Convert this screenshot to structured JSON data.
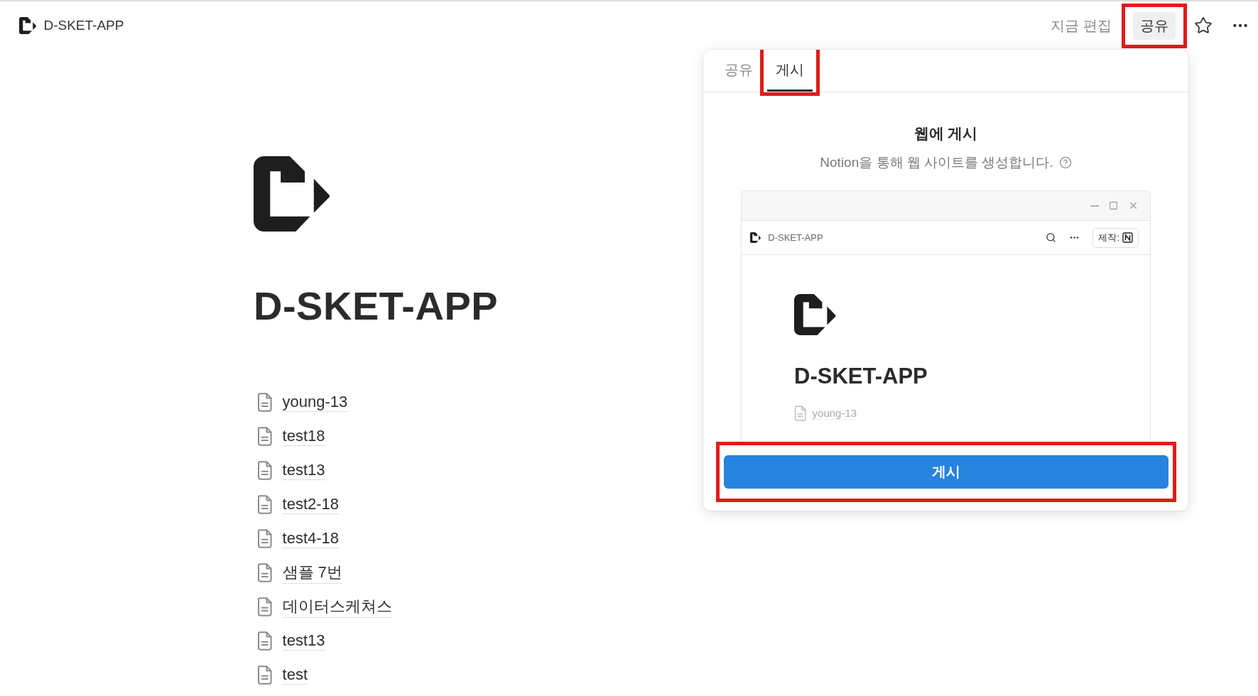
{
  "topbar": {
    "breadcrumb": "D-SKET-APP",
    "edit_status": "지금 편집",
    "share_button": {
      "label": "공유",
      "highlighted": true
    }
  },
  "page": {
    "title": "D-SKET-APP",
    "items": [
      {
        "label": "young-13"
      },
      {
        "label": "test18"
      },
      {
        "label": "test13"
      },
      {
        "label": "test2-18"
      },
      {
        "label": "test4-18"
      },
      {
        "label": "샘플 7번"
      },
      {
        "label": "데이터스케쳐스"
      },
      {
        "label": "test13"
      },
      {
        "label": "test"
      }
    ]
  },
  "popover": {
    "tabs": [
      {
        "label": "공유",
        "selected": false,
        "highlighted": false
      },
      {
        "label": "게시",
        "selected": true,
        "highlighted": true
      }
    ],
    "heading": "웹에 게시",
    "subtitle": "Notion을 통해 웹 사이트를 생성합니다.",
    "preview": {
      "breadcrumb": "D-SKET-APP",
      "made_with": "제작:",
      "title": "D-SKET-APP",
      "items": [
        "young-13"
      ]
    },
    "publish_button": {
      "label": "게시",
      "highlighted": true
    }
  }
}
